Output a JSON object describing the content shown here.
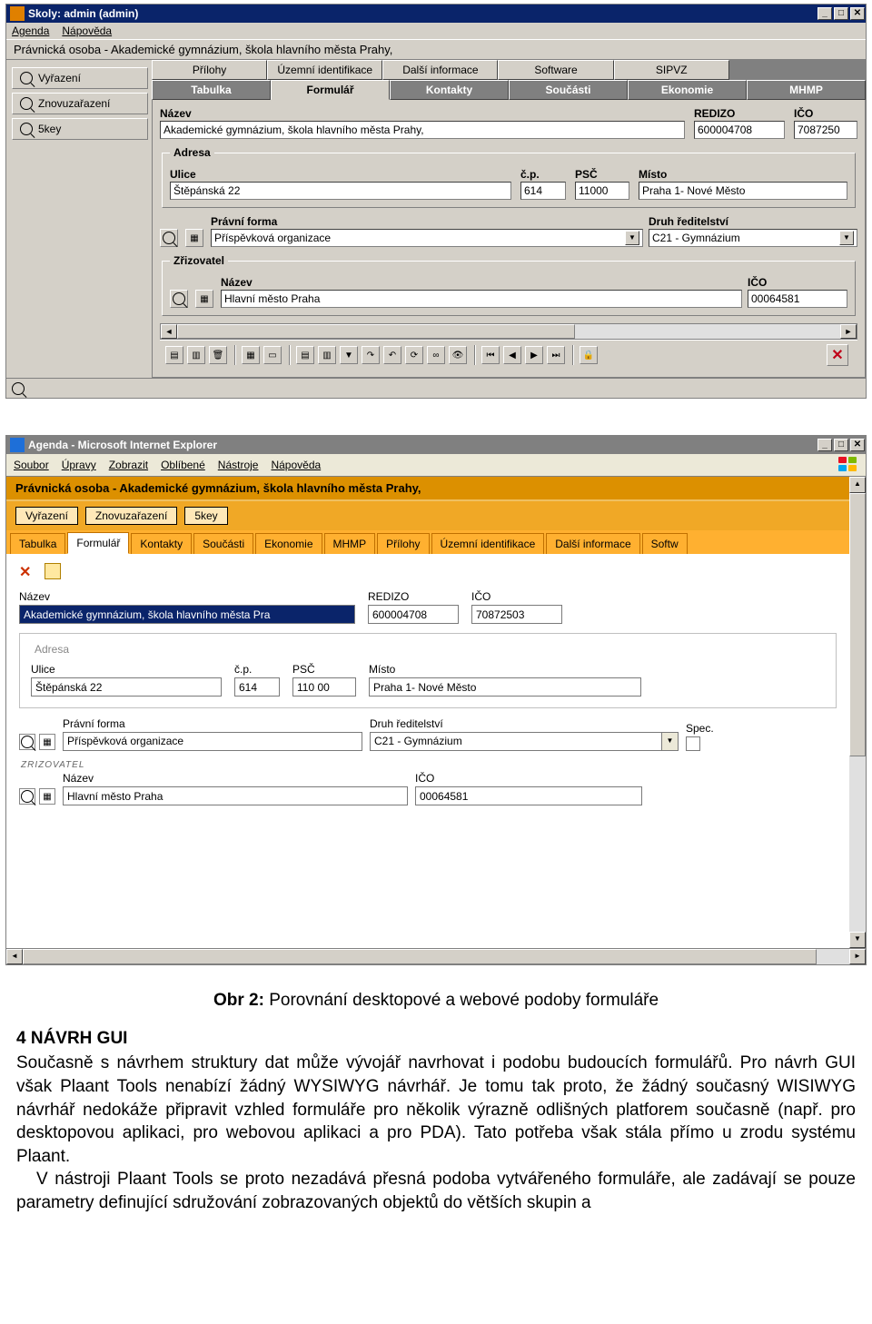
{
  "win1": {
    "title": "Skoly: admin (admin)",
    "menu": {
      "agenda": "Agenda",
      "napoveda": "Nápověda"
    },
    "breadcrumb": "Právnická osoba  -  Akademické gymnázium, škola hlavního města Prahy,",
    "sidebar": {
      "vyrazeni": "Vyřazení",
      "znovuzarazeni": "Znovuzařazení",
      "fivekey": "5key"
    },
    "tabs_top": [
      "Přílohy",
      "Územní identifikace",
      "Další informace",
      "Software",
      "SIPVZ"
    ],
    "tabs_bot": [
      "Tabulka",
      "Formulář",
      "Kontakty",
      "Součásti",
      "Ekonomie",
      "MHMP"
    ],
    "labels": {
      "nazev": "Název",
      "redizo": "REDIZO",
      "ico": "IČO",
      "adresa": "Adresa",
      "ulice": "Ulice",
      "cp": "č.p.",
      "psc": "PSČ",
      "misto": "Místo",
      "pravni_forma": "Právní forma",
      "druh_reditelstvi": "Druh ředitelství",
      "zrizovatel": "Zřizovatel"
    },
    "fields": {
      "nazev": "Akademické gymnázium, škola hlavního města Prahy,",
      "redizo": "600004708",
      "ico": "7087250",
      "ulice": "Štěpánská 22",
      "cp": "614",
      "psc": "11000",
      "misto": "Praha 1- Nové Město",
      "pravni_forma": "Příspěvková organizace",
      "druh_reditelstvi": "C21 - Gymnázium",
      "zriz_nazev": "Hlavní město Praha",
      "zriz_ico": "00064581"
    }
  },
  "win2": {
    "title": "Agenda - Microsoft Internet Explorer",
    "menu": {
      "soubor": "Soubor",
      "upravy": "Úpravy",
      "zobrazit": "Zobrazit",
      "oblibene": "Oblíbené",
      "nastroje": "Nástroje",
      "napoveda": "Nápověda"
    },
    "breadcrumb": "Právnická osoba - Akademické gymnázium, škola hlavního města Prahy,",
    "chips": [
      "Vyřazení",
      "Znovuzařazení",
      "5key"
    ],
    "tabs": [
      "Tabulka",
      "Formulář",
      "Kontakty",
      "Součásti",
      "Ekonomie",
      "MHMP",
      "Přílohy",
      "Územní identifikace",
      "Další informace",
      "Softw"
    ],
    "labels": {
      "nazev": "Název",
      "redizo": "REDIZO",
      "ico": "IČO",
      "adresa": "Adresa",
      "ulice": "Ulice",
      "cp": "č.p.",
      "psc": "PSČ",
      "misto": "Místo",
      "pravni_forma": "Právní forma",
      "druh_reditelstvi": "Druh ředitelství",
      "spec": "Spec.",
      "zrizovatel": "ZRIZOVATEL"
    },
    "fields": {
      "nazev": "Akademické gymnázium, škola hlavního města Pra",
      "redizo": "600004708",
      "ico": "70872503",
      "ulice": "Štěpánská 22",
      "cp": "614",
      "psc": "110 00",
      "misto": "Praha 1- Nové Město",
      "pravni_forma": "Příspěvková organizace",
      "druh_reditelstvi": "C21 - Gymnázium",
      "zriz_nazev": "Hlavní město Praha",
      "zriz_ico": "00064581"
    }
  },
  "doc": {
    "caption_prefix": "Obr 2:",
    "caption": " Porovnání desktopové a webové podoby formuláře",
    "heading": "4  NÁVRH GUI",
    "para1": "Současně s návrhem struktury dat může vývojář navrhovat i podobu budoucích formulářů. Pro návrh GUI však Plaant Tools nenabízí žádný WYSIWYG návrhář. Je tomu tak proto, že žádný současný WISIWYG návrhář nedokáže připravit vzhled formuláře pro několik výrazně odlišných platforem současně (např. pro desktopovou aplikaci, pro webovou aplikaci a pro PDA). Tato potřeba však stála přímo u zrodu systému Plaant.",
    "para2": "V nástroji Plaant Tools se proto nezadává přesná podoba vytvářeného formuláře, ale zadávají se pouze parametry definující sdružování zobrazovaných objektů do větších skupin a"
  }
}
